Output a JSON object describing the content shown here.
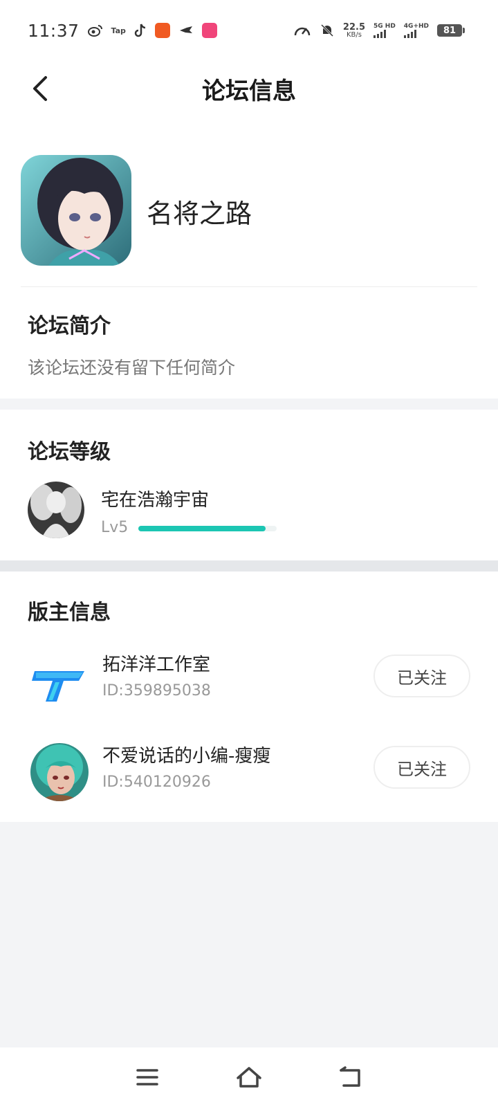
{
  "status_bar": {
    "time": "11:37",
    "tap_label": "Tap",
    "net_speed": "22.5",
    "net_unit": "KB/s",
    "sim1_label": "5G HD",
    "sim2_label": "4G+HD",
    "battery": "81"
  },
  "header": {
    "title": "论坛信息"
  },
  "forum": {
    "name": "名将之路",
    "intro_title": "论坛简介",
    "intro_text": "该论坛还没有留下任何简介"
  },
  "level": {
    "title": "论坛等级",
    "user_name": "宅在浩瀚宇宙",
    "level_label": "Lv5",
    "progress": 0.92
  },
  "moderators": {
    "title": "版主信息",
    "items": [
      {
        "name": "拓洋洋工作室",
        "id": "ID:359895038",
        "button": "已关注"
      },
      {
        "name": "不爱说话的小编-瘦瘦",
        "id": "ID:540120926",
        "button": "已关注"
      }
    ]
  },
  "colors": {
    "accent": "#1CC6B3",
    "background": "#F3F4F6"
  }
}
